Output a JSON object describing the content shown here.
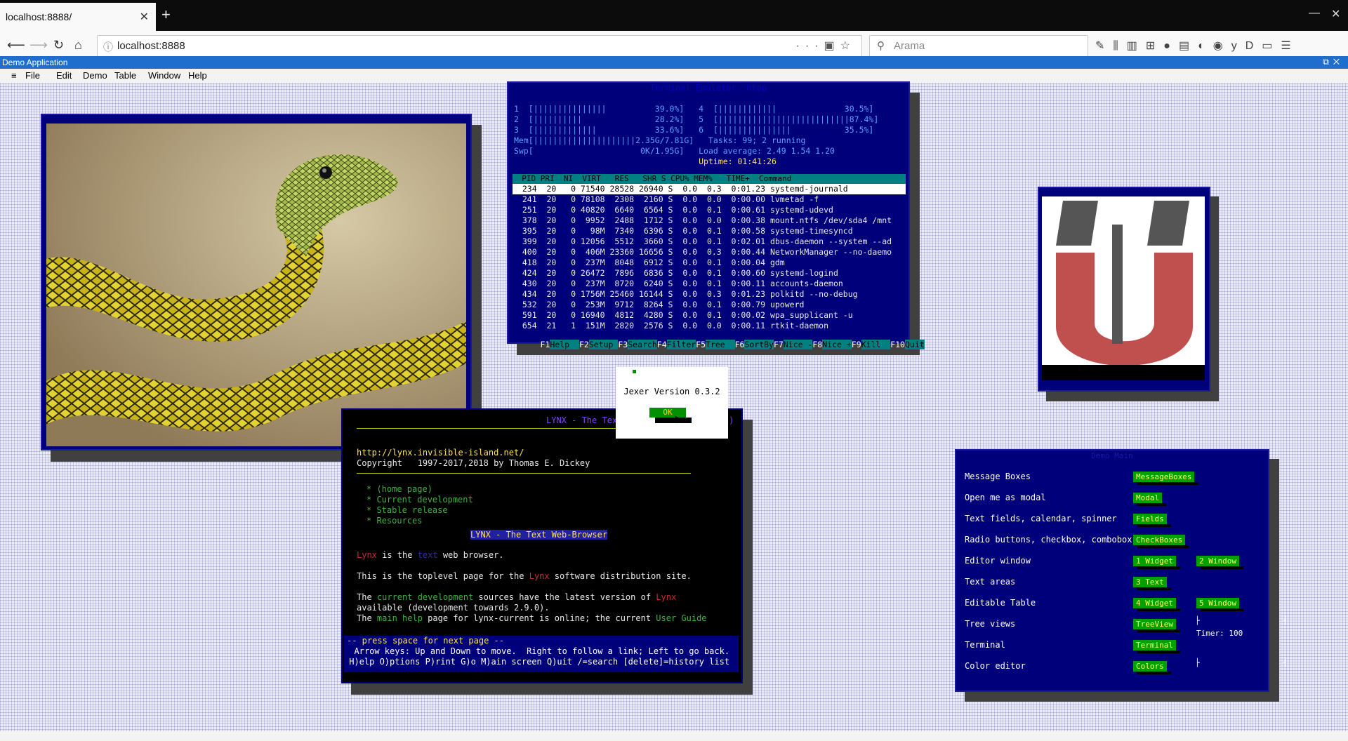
{
  "browser": {
    "tab_title": "localhost:8888/",
    "url": "localhost:8888",
    "search_placeholder": "Arama"
  },
  "app": {
    "title": "Demo Application",
    "menu": [
      "≡",
      "File",
      "Edit",
      "Demo",
      "Table",
      "Window",
      "Help"
    ]
  },
  "htop": {
    "title": "Terminal Emulator: htop",
    "meters": [
      "1  [|||||||||||||||          39.0%]   4  [||||||||||||              30.5%]",
      "2  [||||||||||               28.2%]   5  [|||||||||||||||||||||||||||87.4%]",
      "3  [|||||||||||||            33.6%]   6  [|||||||||||||||           35.5%]",
      "Mem[|||||||||||||||||||||2.35G/7.81G]   Tasks: 99; 2 running",
      "Swp[                      0K/1.95G]   Load average: 2.49 1.54 1.20",
      "                                      Uptime: 01:41:26"
    ],
    "header": "  PID PRI  NI  VIRT   RES   SHR S CPU% MEM%   TIME+  Command",
    "rows": [
      "  234  20   0 71540 28528 26940 S  0.0  0.3  0:01.23 systemd-journald",
      "  241  20   0 78108  2308  2160 S  0.0  0.0  0:00.00 lvmetad -f",
      "  251  20   0 40820  6640  6564 S  0.0  0.1  0:00.61 systemd-udevd",
      "  378  20   0  9952  2488  1712 S  0.0  0.0  0:00.38 mount.ntfs /dev/sda4 /mnt",
      "  395  20   0   98M  7340  6396 S  0.0  0.1  0:00.58 systemd-timesyncd",
      "  399  20   0 12056  5512  3660 S  0.0  0.1  0:02.01 dbus-daemon --system --ad",
      "  400  20   0  406M 23360 16656 S  0.0  0.3  0:00.44 NetworkManager --no-daemo",
      "  418  20   0  237M  8048  6912 S  0.0  0.1  0:00.04 gdm",
      "  424  20   0 26472  7896  6836 S  0.0  0.1  0:00.60 systemd-logind",
      "  430  20   0  237M  8720  6240 S  0.0  0.1  0:00.11 accounts-daemon",
      "  434  20   0 1756M 25460 16144 S  0.0  0.3  0:01.23 polkitd --no-debug",
      "  532  20   0  253M  9712  8264 S  0.0  0.1  0:00.79 upowerd",
      "  591  20   0 16940  4812  4280 S  0.0  0.1  0:00.02 wpa_supplicant -u",
      "  654  21   1  151M  2820  2576 S  0.0  0.0  0:00.11 rtkit-daemon"
    ],
    "footer": [
      {
        "k": "F1",
        "l": "Help  "
      },
      {
        "k": "F2",
        "l": "Setup "
      },
      {
        "k": "F3",
        "l": "Search"
      },
      {
        "k": "F4",
        "l": "Filter"
      },
      {
        "k": "F5",
        "l": "Tree  "
      },
      {
        "k": "F6",
        "l": "SortBy"
      },
      {
        "k": "F7",
        "l": "Nice -"
      },
      {
        "k": "F8",
        "l": "Nice +"
      },
      {
        "k": "F9",
        "l": "Kill  "
      },
      {
        "k": "F10",
        "l": "Quit"
      }
    ]
  },
  "version": {
    "text": "Jexer Version 0.3.2",
    "button": "OK"
  },
  "lynx": {
    "title": "LYNX - The Text Web-Browser (p1 of 3)",
    "url": "http://lynx.invisible-island.net/",
    "copyright": "Copyright   1997-2017,2018 by Thomas E. Dickey",
    "links": [
      "* (home page)",
      "* Current development",
      "* Stable release",
      "* Resources"
    ],
    "heading": "LYNX - The Text Web-Browser",
    "p1_a": "Lynx",
    "p1_b": " is the ",
    "p1_c": "text",
    "p1_d": " web browser.",
    "p2_a": "This is the toplevel page for the ",
    "p2_b": "Lynx",
    "p2_c": " software distribution site.",
    "p3_a": "The ",
    "p3_b": "current development",
    "p3_c": " sources have the latest version of ",
    "p3_d": "Lynx",
    "p3_line2": "available (development towards 2.9.0).",
    "p4_a": "The ",
    "p4_b": "main help",
    "p4_c": " page for lynx-current is online; the current ",
    "p4_d": "User Guide",
    "status1": "-- press space for next page --",
    "status2": "  Arrow keys: Up and Down to move.  Right to follow a link; Left to go back.",
    "status3": " H)elp O)ptions P)rint G)o M)ain screen Q)uit /=search [delete]=history list"
  },
  "demo": {
    "title": "Demo Main",
    "rows": [
      {
        "label": "Message Boxes",
        "buttons": [
          "MessageBoxes"
        ]
      },
      {
        "label": "Open me as modal",
        "buttons": [
          "Modal"
        ]
      },
      {
        "label": "Text fields, calendar, spinner",
        "buttons": [
          "Fields"
        ]
      },
      {
        "label": "Radio buttons, checkbox, combobox",
        "buttons": [
          "CheckBoxes"
        ]
      },
      {
        "label": "Editor window",
        "buttons": [
          "1 Widget",
          "2 Window"
        ]
      },
      {
        "label": "Text areas",
        "buttons": [
          "3 Text"
        ]
      },
      {
        "label": "Editable Table",
        "buttons": [
          "4 Widget",
          "5 Window"
        ]
      },
      {
        "label": "Tree views",
        "buttons": [
          "TreeView"
        ]
      },
      {
        "label": "Terminal",
        "buttons": [
          "Terminal"
        ]
      },
      {
        "label": "Color editor",
        "buttons": [
          "Colors"
        ]
      }
    ],
    "timer": "Timer: 100"
  }
}
